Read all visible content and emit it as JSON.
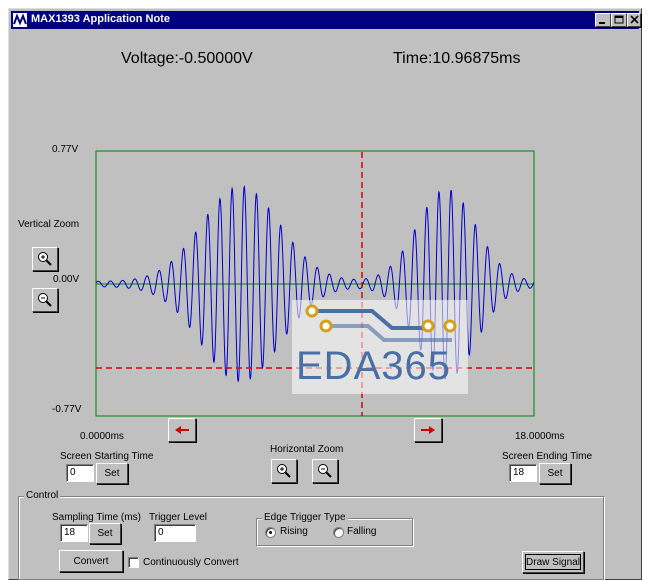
{
  "window": {
    "title": "MAX1393 Application Note"
  },
  "readout": {
    "voltage": "Voltage:-0.50000V",
    "time": "Time:10.96875ms"
  },
  "plot": {
    "y_max_label": "0.77V",
    "y_zero_label": "0.00V",
    "y_min_label": "-0.77V",
    "x_start_label": "0.0000ms",
    "x_end_label": "18.0000ms",
    "grid_color": "#008000",
    "trace_color": "#0000cc",
    "cursor_color": "#dd0000"
  },
  "vertical_zoom": {
    "label": "Vertical Zoom"
  },
  "horizontal_zoom": {
    "label": "Horizontal Zoom"
  },
  "screen_start": {
    "label": "Screen Starting Time",
    "value": "0",
    "button": "Set"
  },
  "screen_end": {
    "label": "Screen Ending Time",
    "value": "18",
    "button": "Set"
  },
  "control": {
    "title": "Control",
    "sampling": {
      "label": "Sampling Time (ms)",
      "value": "18",
      "button": "Set"
    },
    "trigger": {
      "label": "Trigger Level",
      "value": "0"
    },
    "edge": {
      "title": "Edge Trigger Type",
      "rising": "Rising",
      "falling": "Falling",
      "selected": "Rising"
    },
    "convert_button": "Convert",
    "continuous_label": "Continuously Convert",
    "draw_button": "Draw Signal"
  },
  "watermark": {
    "text": "EDA365"
  }
}
